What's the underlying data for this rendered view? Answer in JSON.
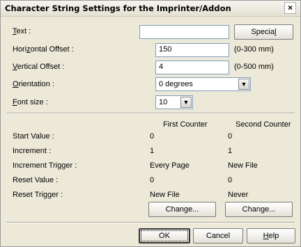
{
  "window": {
    "title": "Character String Settings for the Imprinter/Addon",
    "close": "×"
  },
  "text_row": {
    "label_u": "T",
    "label_rest": "ext :",
    "value": "",
    "special_u": "l",
    "special_pre": "Specia"
  },
  "horizontal": {
    "label_pre": "Hori",
    "label_u": "z",
    "label_post": "ontal Offset :",
    "value": "150",
    "range": "(0-300 mm)"
  },
  "vertical": {
    "label_u": "V",
    "label_rest": "ertical Offset :",
    "value": "4",
    "range": "(0-500 mm)"
  },
  "orientation": {
    "label_u": "O",
    "label_rest": "rientation :",
    "value": "0 degrees"
  },
  "font_size": {
    "label_u": "F",
    "label_rest": "ont size :",
    "value": "10"
  },
  "counters": {
    "col1": "First Counter",
    "col2": "Second Counter",
    "rows": [
      {
        "label": "Start Value :",
        "first": "0",
        "second": "0"
      },
      {
        "label": "Increment :",
        "first": "1",
        "second": "1"
      },
      {
        "label": "Increment Trigger :",
        "first": "Every Page",
        "second": "New File"
      },
      {
        "label": "Reset Value :",
        "first": "0",
        "second": "0"
      },
      {
        "label": "Reset Trigger :",
        "first": "New File",
        "second": "Never"
      }
    ],
    "change_pre": "Chan",
    "change_u": "g",
    "change_post": "e..."
  },
  "footer": {
    "ok": "OK",
    "cancel": "Cancel",
    "help_u": "H",
    "help_rest": "elp"
  }
}
